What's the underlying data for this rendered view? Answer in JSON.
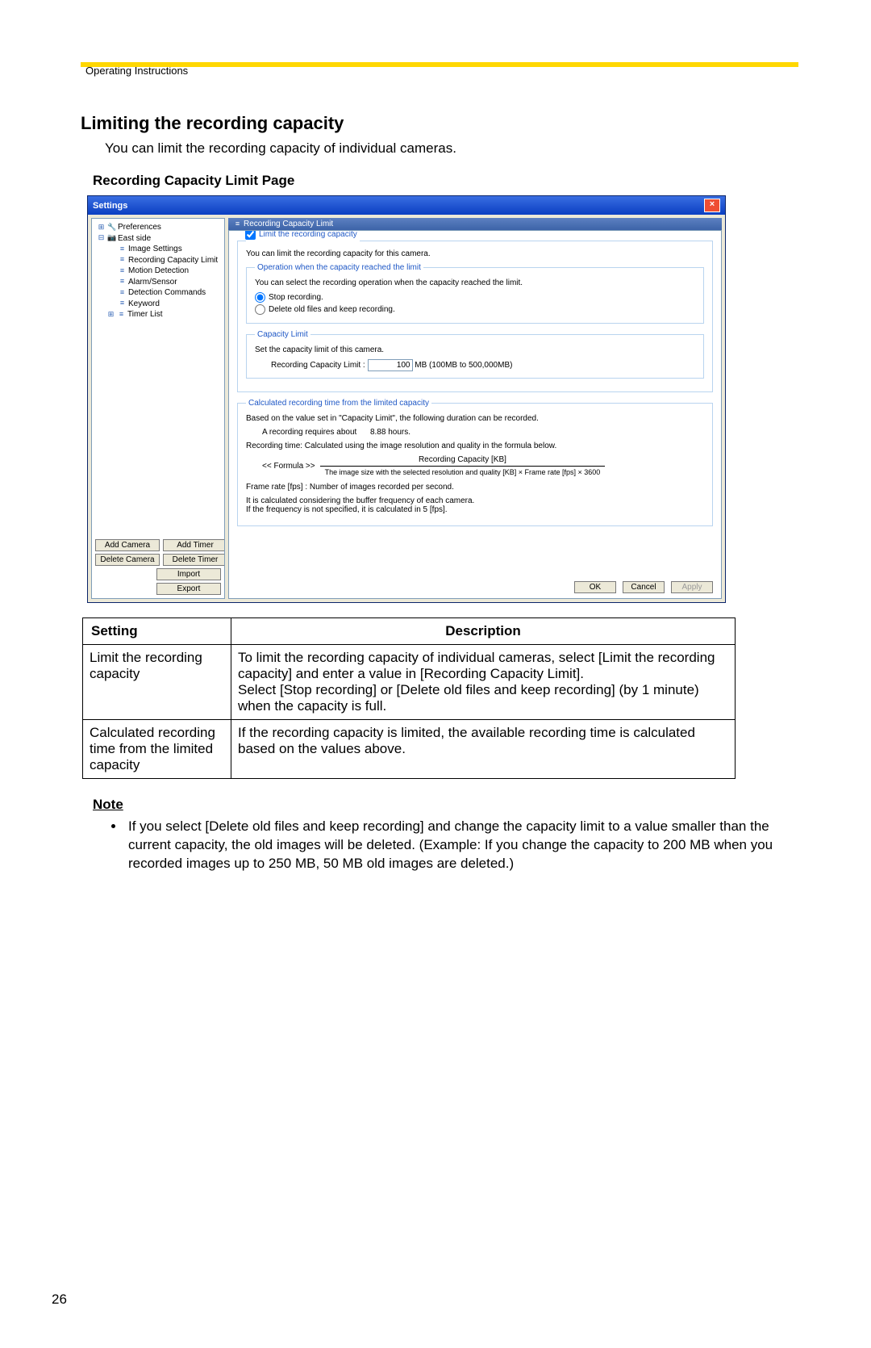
{
  "header": "Operating Instructions",
  "title": "Limiting the recording capacity",
  "intro": "You can limit the recording capacity of individual cameras.",
  "subhead": "Recording Capacity Limit Page",
  "window": {
    "title": "Settings",
    "panel_title": "Recording Capacity Limit",
    "tree": {
      "preferences": "Preferences",
      "east_side": "East side",
      "image_settings": "Image Settings",
      "rcl": "Recording Capacity Limit",
      "motion": "Motion Detection",
      "alarm": "Alarm/Sensor",
      "det_commands": "Detection Commands",
      "keyword": "Keyword",
      "timer": "Timer List"
    },
    "side_buttons": {
      "add_camera": "Add Camera",
      "add_timer": "Add Timer",
      "delete_camera": "Delete Camera",
      "delete_timer": "Delete Timer",
      "import": "Import",
      "export": "Export"
    },
    "fieldsets": {
      "limit_legend": "Limit the recording capacity",
      "limit_desc": "You can limit the recording capacity for this camera.",
      "op_legend": "Operation when the capacity reached the limit",
      "op_desc": "You can select the recording operation when the capacity reached the limit.",
      "radio_stop": "Stop recording.",
      "radio_delete": "Delete old files and keep recording.",
      "cap_legend": "Capacity Limit",
      "cap_desc": "Set the capacity limit of this camera.",
      "cap_label": "Recording Capacity Limit :",
      "cap_value": "100",
      "cap_suffix": "MB  (100MB to 500,000MB)",
      "calc_legend": "Calculated recording time from the limited capacity",
      "calc_desc": "Based on the value set in \"Capacity Limit\", the following duration can be recorded.",
      "calc_req": "A recording requires about",
      "calc_hours": "8.88  hours.",
      "calc_note": "Recording time: Calculated using the image resolution and quality in the formula below.",
      "formula_label": "<< Formula >>",
      "formula_num": "Recording Capacity [KB]",
      "formula_den": "The image size with the selected resolution and quality [KB] × Frame rate [fps] × 3600",
      "fps_note": "Frame rate [fps] : Number of images recorded per second.",
      "fps_note2": "It is calculated considering the buffer frequency of each camera.\nIf the frequency is not specified, it is calculated in 5 [fps].",
      "ok": "OK",
      "cancel": "Cancel",
      "apply": "Apply"
    }
  },
  "table": {
    "header_setting": "Setting",
    "header_desc": "Description",
    "rows": [
      {
        "setting": "Limit the recording capacity",
        "desc": "To limit the recording capacity of individual cameras, select [Limit the recording capacity] and enter a value in [Recording Capacity Limit].\nSelect [Stop recording] or [Delete old files and keep recording] (by 1 minute) when the capacity is full."
      },
      {
        "setting": "Calculated recording time from the limited capacity",
        "desc": "If the recording capacity is limited, the available recording time is calculated based on the values above."
      }
    ]
  },
  "note_head": "Note",
  "note_item": "If you select [Delete old files and keep recording] and change the capacity limit to a value smaller than the current capacity, the old images will be deleted. (Example: If you change the capacity to 200 MB when you recorded images up to 250 MB, 50 MB old images are deleted.)",
  "page_num": "26"
}
